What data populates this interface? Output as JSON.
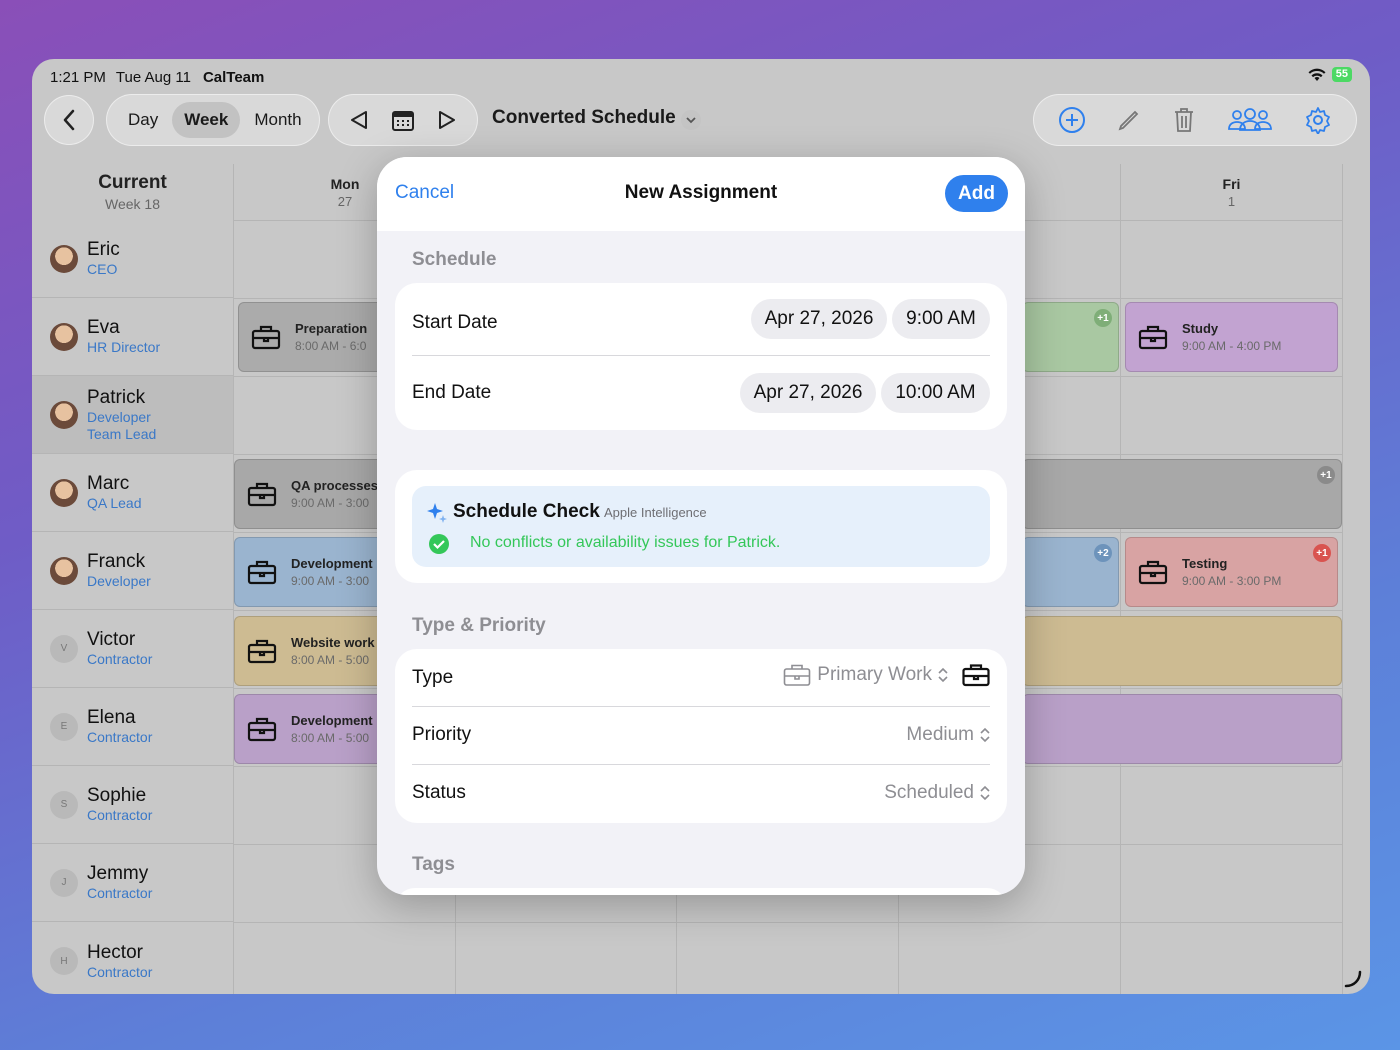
{
  "status_bar": {
    "time": "1:21 PM",
    "date": "Tue Aug 11",
    "app": "CalTeam",
    "battery": "55"
  },
  "toolbar": {
    "back_icon": "chevron-left-icon",
    "segments": [
      "Day",
      "Week",
      "Month"
    ],
    "active_segment": "Week",
    "schedule_name": "Converted Schedule"
  },
  "grid": {
    "corner_title": "Current",
    "corner_sub": "Week 18",
    "days": [
      {
        "name": "Mon",
        "num": "27"
      },
      {
        "name": "Fri",
        "num": "1"
      }
    ],
    "people": [
      {
        "name": "Eric",
        "role": "CEO",
        "initial": "",
        "photo": true
      },
      {
        "name": "Eva",
        "role": "HR Director",
        "initial": "",
        "photo": true
      },
      {
        "name": "Patrick",
        "role": "Developer\nTeam Lead",
        "role1": "Developer",
        "role2": "Team Lead",
        "initial": "",
        "photo": true
      },
      {
        "name": "Marc",
        "role": "QA Lead",
        "initial": "",
        "photo": true
      },
      {
        "name": "Franck",
        "role": "Developer",
        "initial": "",
        "photo": true
      },
      {
        "name": "Victor",
        "role": "Contractor",
        "initial": "V",
        "photo": false
      },
      {
        "name": "Elena",
        "role": "Contractor",
        "initial": "E",
        "photo": false
      },
      {
        "name": "Sophie",
        "role": "Contractor",
        "initial": "S",
        "photo": false
      },
      {
        "name": "Jemmy",
        "role": "Contractor",
        "initial": "J",
        "photo": false
      },
      {
        "name": "Hector",
        "role": "Contractor",
        "initial": "H",
        "photo": false
      }
    ],
    "events": [
      {
        "title": "Preparation",
        "time": "8:00 AM - 6:0",
        "color": "#aaaaaa"
      },
      {
        "title": "QA processes",
        "time": "9:00 AM - 3:00",
        "color": "#a8a8a8"
      },
      {
        "title": "Development",
        "time": "9:00 AM - 3:00",
        "color": "#9ab4cf"
      },
      {
        "title": "Website work",
        "time": "8:00 AM - 5:00",
        "color": "#cdbb92"
      },
      {
        "title": "Development",
        "time": "8:00 AM - 5:00",
        "color": "#b9a0c8"
      },
      {
        "title": "Study",
        "time": "9:00 AM - 4:00 PM",
        "color": "#c3a4d2"
      },
      {
        "title": "Testing",
        "time": "9:00 AM - 3:00 PM",
        "color": "#d8a3a3"
      }
    ],
    "badges": [
      "+1",
      "+1",
      "+2",
      "+1"
    ]
  },
  "modal": {
    "cancel": "Cancel",
    "title": "New Assignment",
    "add": "Add",
    "schedule_section": "Schedule",
    "start_label": "Start Date",
    "start_date": "Apr 27, 2026",
    "start_time": "9:00 AM",
    "end_label": "End Date",
    "end_date": "Apr 27, 2026",
    "end_time": "10:00 AM",
    "check_title": "Schedule Check",
    "check_sub": "Apple Intelligence",
    "check_msg": "No conflicts or availability issues for Patrick.",
    "type_section": "Type & Priority",
    "type_label": "Type",
    "type_value": "Primary Work",
    "priority_label": "Priority",
    "priority_value": "Medium",
    "status_label": "Status",
    "status_value": "Scheduled",
    "tags_section": "Tags"
  },
  "colors": {
    "accent": "#2f80ed",
    "success": "#34c759"
  }
}
